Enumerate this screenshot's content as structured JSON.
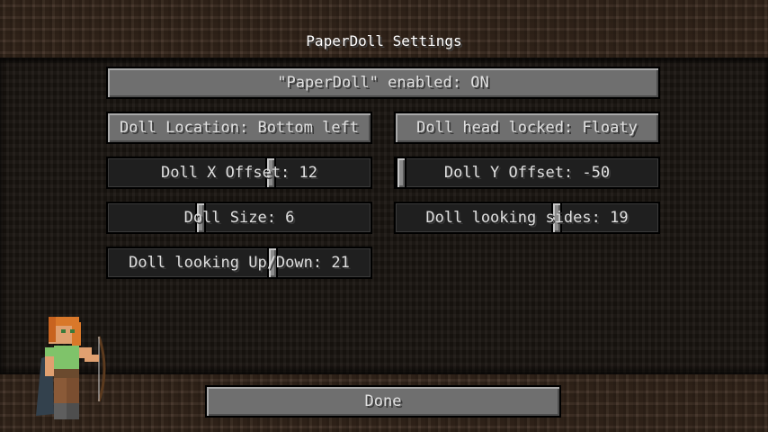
{
  "screen": {
    "title": "PaperDoll Settings"
  },
  "buttons": {
    "enabled": "\"PaperDoll\" enabled: ON",
    "location": "Doll Location: Bottom left",
    "head_locked": "Doll head locked: Floaty",
    "done": "Done"
  },
  "sliders": {
    "x_offset": {
      "label": "Doll X Offset: 12",
      "value": 12
    },
    "y_offset": {
      "label": "Doll Y Offset: -50",
      "value": -50
    },
    "size": {
      "label": "Doll Size: 6",
      "value": 6
    },
    "looking_sides": {
      "label": "Doll looking sides: 19",
      "value": 19
    },
    "looking_updown": {
      "label": "Doll looking Up/Down: 21",
      "value": 21
    }
  }
}
